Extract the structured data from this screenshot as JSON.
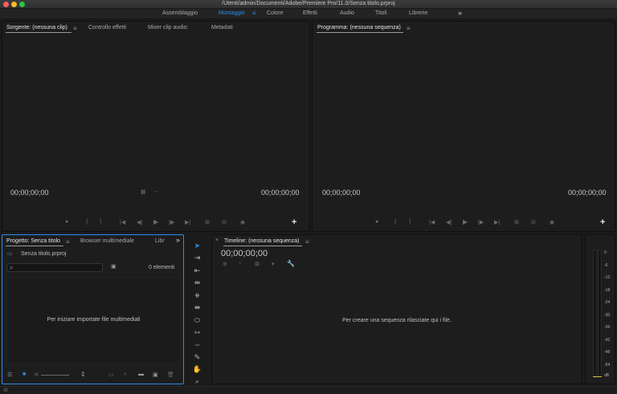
{
  "window": {
    "title": "/Utenti/admin/Documenti/Adobe/Premiere Pro/11.0/Senza titolo.prproj"
  },
  "workspaces": [
    {
      "label": "Assemblaggio"
    },
    {
      "label": "Montaggio",
      "active": true
    },
    {
      "label": "Colore"
    },
    {
      "label": "Effetti"
    },
    {
      "label": "Audio"
    },
    {
      "label": "Titoli"
    },
    {
      "label": "Librerie"
    },
    {
      "label": "»"
    }
  ],
  "source": {
    "tabs": [
      "Sorgente: (nessuna clip)",
      "Controllo effetti",
      "Mixer clip audio:",
      "Metadati"
    ],
    "tc_left": "00;00;00;00",
    "tc_right": "00;00;00;00"
  },
  "program": {
    "tab": "Programma: (nessuna sequenza)",
    "tc_left": "00;00;00;00",
    "tc_right": "00;00;00;00"
  },
  "project": {
    "tabs": [
      "Progetto: Senza titolo",
      "Browser multimediale",
      "Libr"
    ],
    "more": "»",
    "file": "Senza titolo.prproj",
    "search_placeholder": "",
    "count": "0 elementi",
    "empty": "Per iniziare importate file multimediali"
  },
  "timeline": {
    "tab": "Timeline: (nessuna sequenza)",
    "tc": "00;00;00;00",
    "empty": "Per creare una sequenza rilasciate qui i file."
  },
  "meter": {
    "scale": [
      "0",
      "-6",
      "-12",
      "-18",
      "-24",
      "-30",
      "-36",
      "-42",
      "-48",
      "-54",
      "dB"
    ]
  },
  "colors": {
    "accent": "#2d8ceb",
    "panel_bg": "#1d1d1d",
    "app_bg": "#1b1b1b"
  },
  "icons": {
    "tools": [
      "selection-tool-icon",
      "track-select-icon",
      "ripple-edit-icon",
      "rolling-edit-icon",
      "rate-stretch-icon",
      "razor-icon",
      "slip-icon",
      "slide-icon",
      "pen-icon",
      "hand-icon",
      "zoom-icon"
    ]
  }
}
